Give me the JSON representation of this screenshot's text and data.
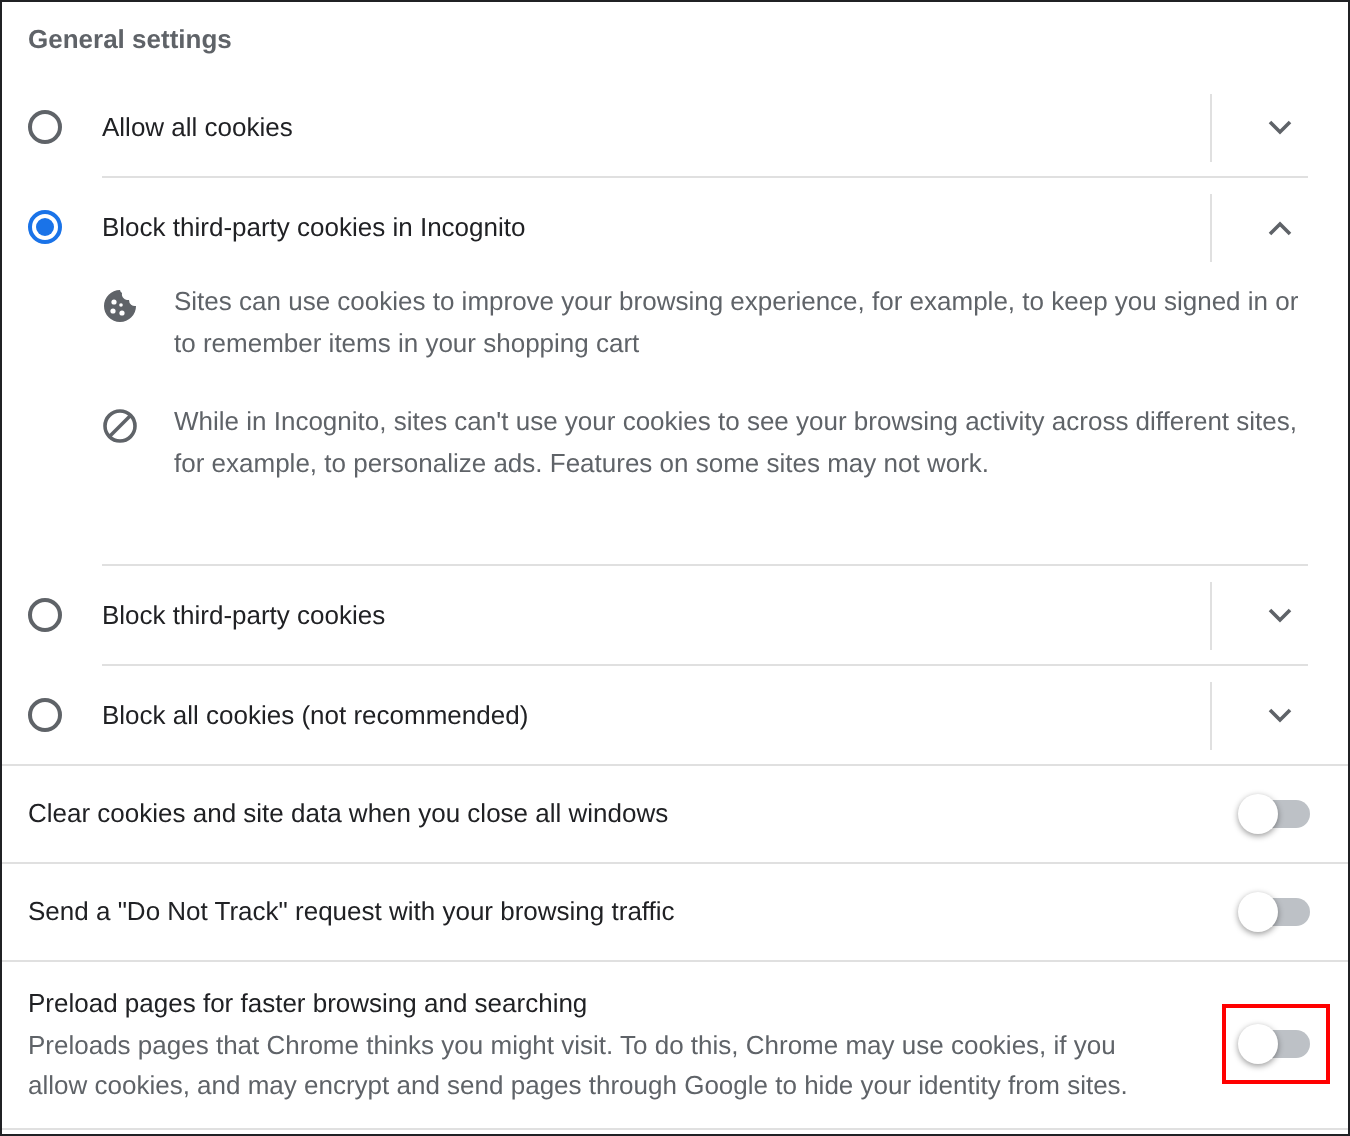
{
  "heading": "General settings",
  "cookie_options": [
    {
      "label": "Allow all cookies",
      "selected": false,
      "expanded": false
    },
    {
      "label": "Block third-party cookies in Incognito",
      "selected": true,
      "expanded": true,
      "details": [
        {
          "kind": "cookie",
          "text": "Sites can use cookies to improve your browsing experience, for example, to keep you signed in or to remember items in your shopping cart"
        },
        {
          "kind": "blocked",
          "text": "While in Incognito, sites can't use your cookies to see your browsing activity across different sites, for example, to personalize ads. Features on some sites may not work."
        }
      ]
    },
    {
      "label": "Block third-party cookies",
      "selected": false,
      "expanded": false
    },
    {
      "label": "Block all cookies (not recommended)",
      "selected": false,
      "expanded": false
    }
  ],
  "toggles": [
    {
      "label": "Clear cookies and site data when you close all windows",
      "on": false,
      "highlighted": false
    },
    {
      "label": "Send a \"Do Not Track\" request with your browsing traffic",
      "on": false,
      "highlighted": false
    },
    {
      "label": "Preload pages for faster browsing and searching",
      "description": "Preloads pages that Chrome thinks you might visit. To do this, Chrome may use cookies, if you allow cookies, and may encrypt and send pages through Google to hide your identity from sites.",
      "on": false,
      "highlighted": true
    }
  ]
}
